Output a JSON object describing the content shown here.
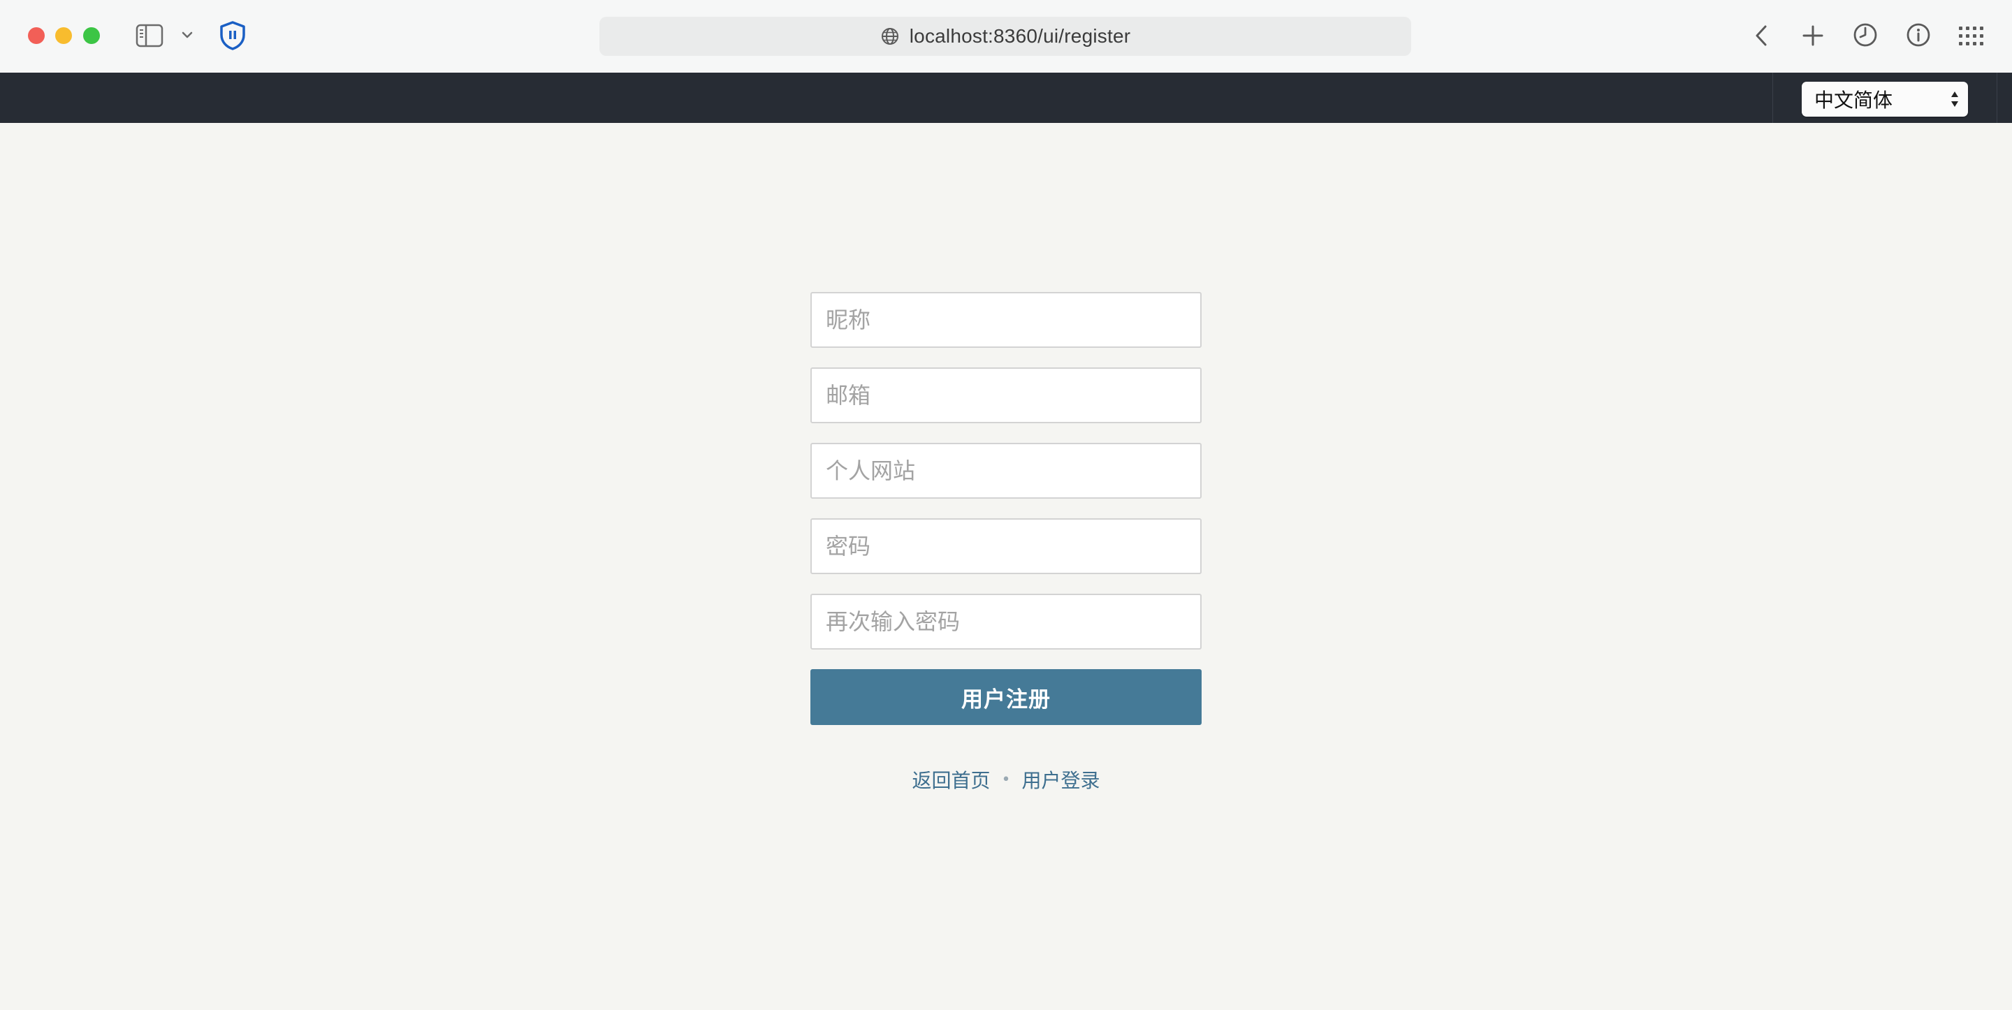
{
  "browser": {
    "url": "localhost:8360/ui/register",
    "icons": [
      "sidebar-icon",
      "chevron-down-icon",
      "shield-icon",
      "globe-icon",
      "back-icon",
      "plus-icon",
      "clock-icon",
      "info-icon",
      "grid-icon"
    ]
  },
  "nav": {
    "language_selected": "中文简体"
  },
  "form": {
    "nickname_placeholder": "昵称",
    "email_placeholder": "邮箱",
    "website_placeholder": "个人网站",
    "password_placeholder": "密码",
    "confirm_password_placeholder": "再次输入密码",
    "submit_label": "用户注册"
  },
  "links": {
    "home": "返回首页",
    "separator": "•",
    "login": "用户登录"
  },
  "colors": {
    "nav_bg": "#272c34",
    "page_bg": "#f5f5f2",
    "button_bg": "#457a97",
    "link": "#3e6f8f"
  }
}
